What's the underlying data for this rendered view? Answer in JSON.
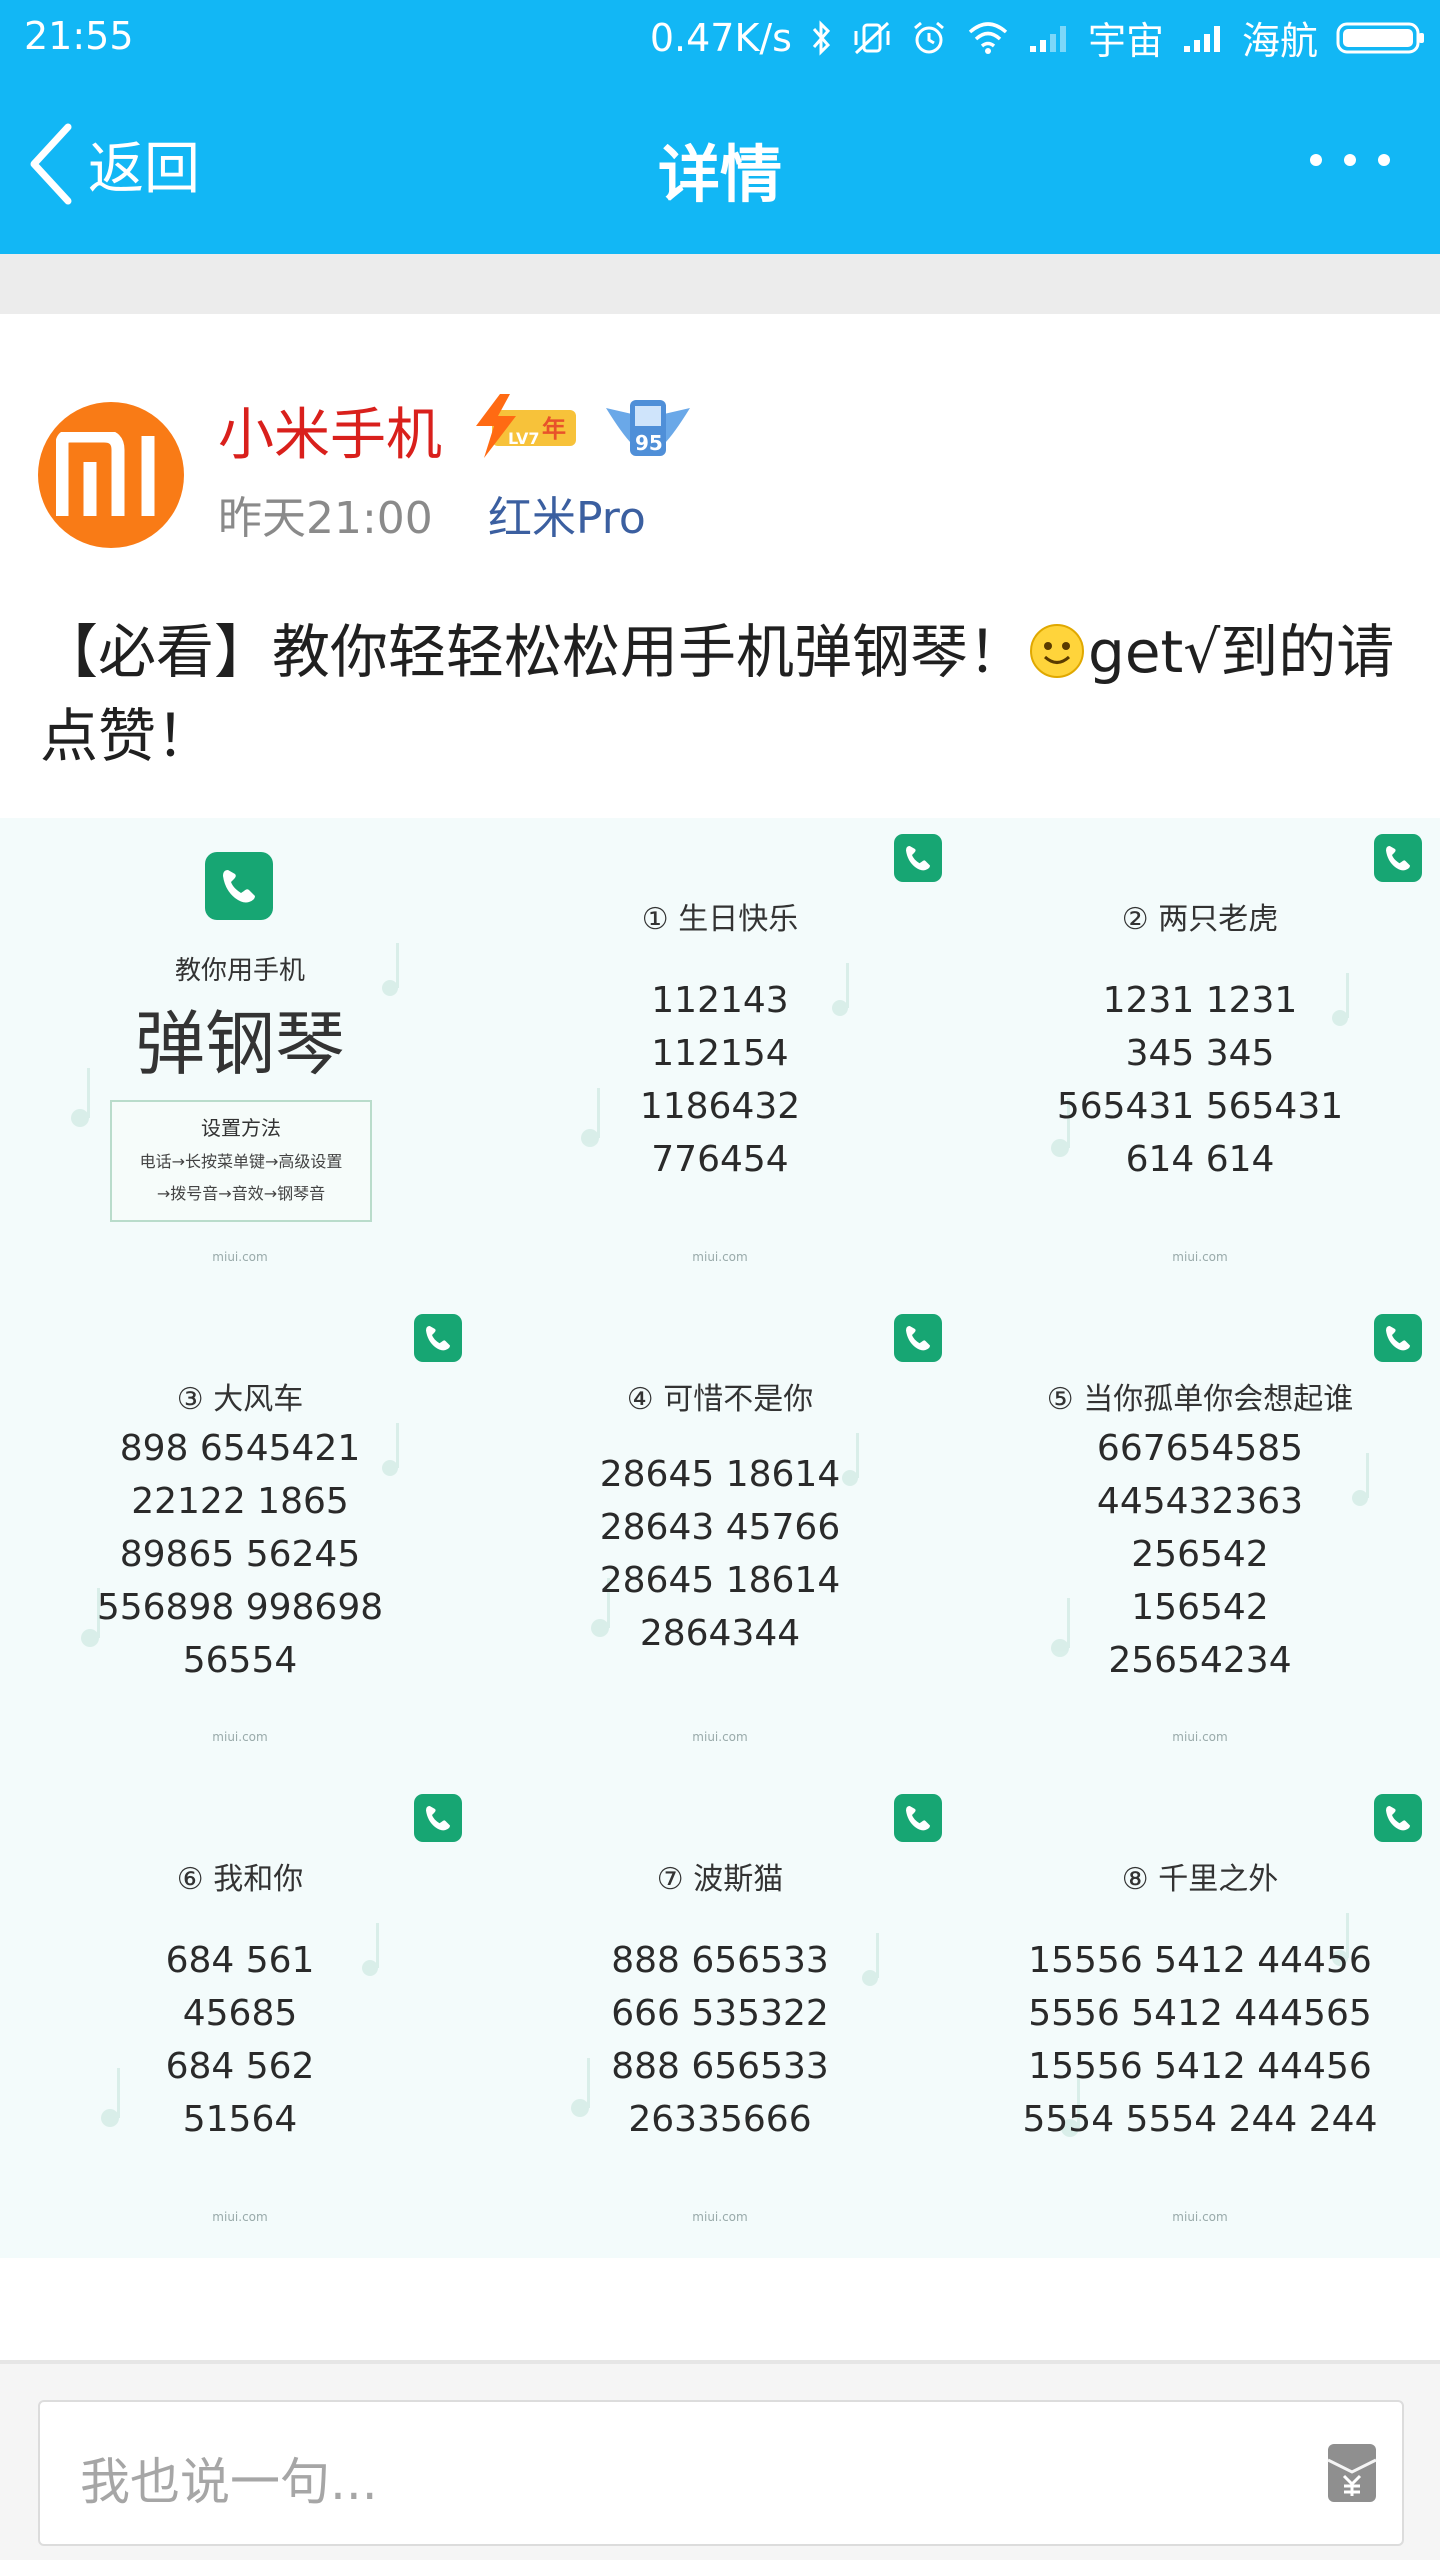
{
  "status_bar": {
    "time": "21:55",
    "speed": "0.47K/s",
    "carrier1": "宇宙",
    "carrier2": "海航",
    "icons": [
      "bluetooth-icon",
      "mute-vibrate-icon",
      "alarm-icon",
      "wifi-icon",
      "signal-icon",
      "battery-icon"
    ]
  },
  "nav": {
    "back_label": "返回",
    "title": "详情"
  },
  "author": {
    "name": "小米手机",
    "level_badge": "LV7",
    "year_badge": "年",
    "wing_badge": "95",
    "time": "昨天21:00",
    "device": "红米Pro"
  },
  "post": {
    "text_before_emoji": "【必看】教你轻轻松松用手机弹钢琴！",
    "text_after_emoji": "get√到的请点赞！"
  },
  "images": {
    "cover": {
      "teach": "教你用手机",
      "piano": "弹钢琴",
      "how_title": "设置方法",
      "how_line1": "电话→长按菜单键→高级设置",
      "how_line2": "→拨号音→音效→钢琴音",
      "footer": "miui.com"
    },
    "songs": [
      {
        "title": "① 生日快乐",
        "lines": [
          "112143",
          "112154",
          "1186432",
          "776454"
        ],
        "footer": "miui.com"
      },
      {
        "title": "② 两只老虎",
        "lines": [
          "1231 1231",
          "345 345",
          "565431 565431",
          "614 614"
        ],
        "footer": "miui.com"
      },
      {
        "title": "③ 大风车",
        "lines": [
          "898 6545421",
          "22122 1865",
          "89865 56245",
          "556898 998698",
          "56554"
        ],
        "footer": "miui.com"
      },
      {
        "title": "④ 可惜不是你",
        "lines": [
          "28645 18614",
          "28643 45766",
          "28645 18614",
          "2864344"
        ],
        "footer": "miui.com"
      },
      {
        "title": "⑤ 当你孤单你会想起谁",
        "lines": [
          "667654585",
          "445432363",
          "256542",
          "156542",
          "25654234"
        ],
        "footer": "miui.com"
      },
      {
        "title": "⑥ 我和你",
        "lines": [
          "684 561",
          "45685",
          "684 562",
          "51564"
        ],
        "footer": "miui.com"
      },
      {
        "title": "⑦ 波斯猫",
        "lines": [
          "888 656533",
          "666 535322",
          "888 656533",
          "26335666"
        ],
        "footer": "miui.com"
      },
      {
        "title": "⑧ 千里之外",
        "lines": [
          "15556 5412 44456",
          "5556 5412 444565",
          "15556 5412 44456",
          "5554 5554 244 244"
        ],
        "footer": "miui.com"
      }
    ]
  },
  "comment": {
    "placeholder": "我也说一句..."
  },
  "colors": {
    "header": "#12b7f5",
    "name_red": "#d9201c",
    "device_blue": "#3b5fa0",
    "mi_orange": "#f97b16",
    "phone_green": "#17a673"
  }
}
